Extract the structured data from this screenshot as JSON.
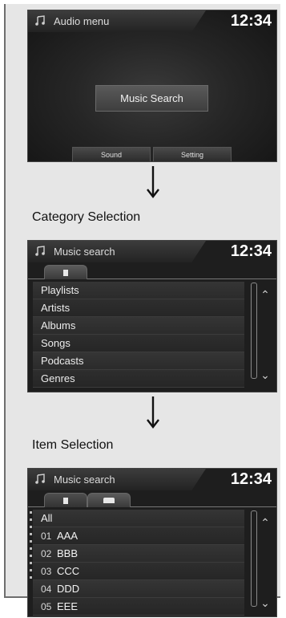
{
  "screens": [
    {
      "title": "Audio menu",
      "clock": "12:34",
      "center_button": "Music Search",
      "bottom_buttons": [
        "Sound",
        "Setting"
      ]
    },
    {
      "title": "Music search",
      "clock": "12:34",
      "items": [
        "Playlists",
        "Artists",
        "Albums",
        "Songs",
        "Podcasts",
        "Genres"
      ]
    },
    {
      "title": "Music search",
      "clock": "12:34",
      "items": [
        {
          "num": "",
          "text": "All"
        },
        {
          "num": "01",
          "text": "AAA"
        },
        {
          "num": "02",
          "text": "BBB"
        },
        {
          "num": "03",
          "text": "CCC"
        },
        {
          "num": "04",
          "text": "DDD"
        },
        {
          "num": "05",
          "text": "EEE"
        }
      ]
    }
  ],
  "captions": [
    "Category Selection",
    "Item Selection"
  ],
  "icons": {
    "note": "music-note-icon",
    "arrow": "down-arrow-icon",
    "scroll_up": "double-chevron-up-icon",
    "scroll_down": "double-chevron-down-icon"
  },
  "colors": {
    "screen_bg": "#1e1e1e",
    "panel_bg": "#e6e6e6",
    "text": "#ececec"
  }
}
